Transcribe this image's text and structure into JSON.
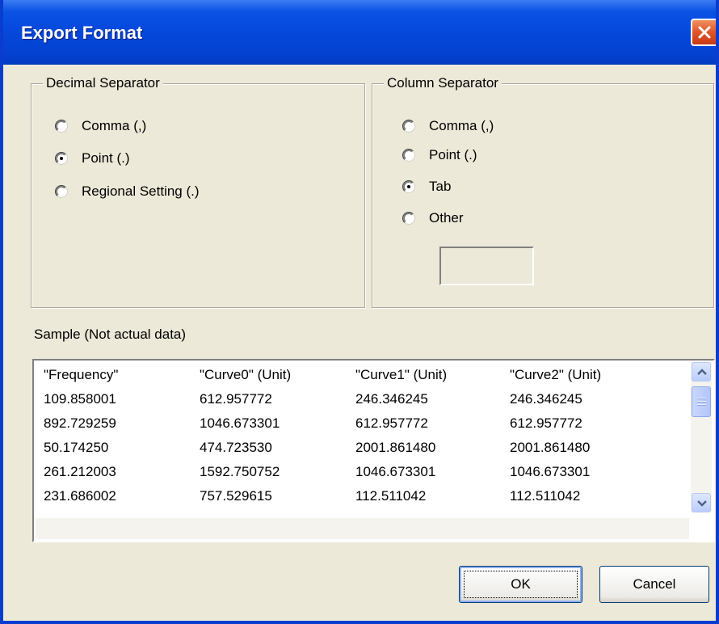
{
  "window": {
    "title": "Export Format"
  },
  "decimal_separator": {
    "label": "Decimal Separator",
    "options": [
      {
        "label": "Comma (,)",
        "checked": false
      },
      {
        "label": "Point (.)",
        "checked": true
      },
      {
        "label": "Regional Setting (.)",
        "checked": false
      }
    ]
  },
  "column_separator": {
    "label": "Column Separator",
    "options": [
      {
        "label": "Comma (,)",
        "checked": false
      },
      {
        "label": "Point (.)",
        "checked": false
      },
      {
        "label": "Tab",
        "checked": true
      },
      {
        "label": "Other",
        "checked": false
      }
    ],
    "other_value": ""
  },
  "sample": {
    "label": "Sample (Not actual data)",
    "headers": [
      "\"Frequency\"",
      "\"Curve0\" (Unit)",
      "\"Curve1\" (Unit)",
      "\"Curve2\" (Unit)"
    ],
    "rows": [
      [
        "109.858001",
        "612.957772",
        "246.346245",
        "246.346245"
      ],
      [
        "892.729259",
        "1046.673301",
        "612.957772",
        "612.957772"
      ],
      [
        "50.174250",
        "474.723530",
        "2001.861480",
        "2001.861480"
      ],
      [
        "261.212003",
        "1592.750752",
        "1046.673301",
        "1046.673301"
      ],
      [
        "231.686002",
        "757.529615",
        "112.511042",
        "112.511042"
      ]
    ]
  },
  "buttons": {
    "ok": "OK",
    "cancel": "Cancel"
  },
  "icons": {
    "close": "close-icon",
    "scroll_up": "chevron-up-icon",
    "scroll_down": "chevron-down-icon"
  },
  "colors": {
    "titlebar": "#0548db",
    "dialog_background": "#ece9d8",
    "close_button": "#e0542a"
  }
}
